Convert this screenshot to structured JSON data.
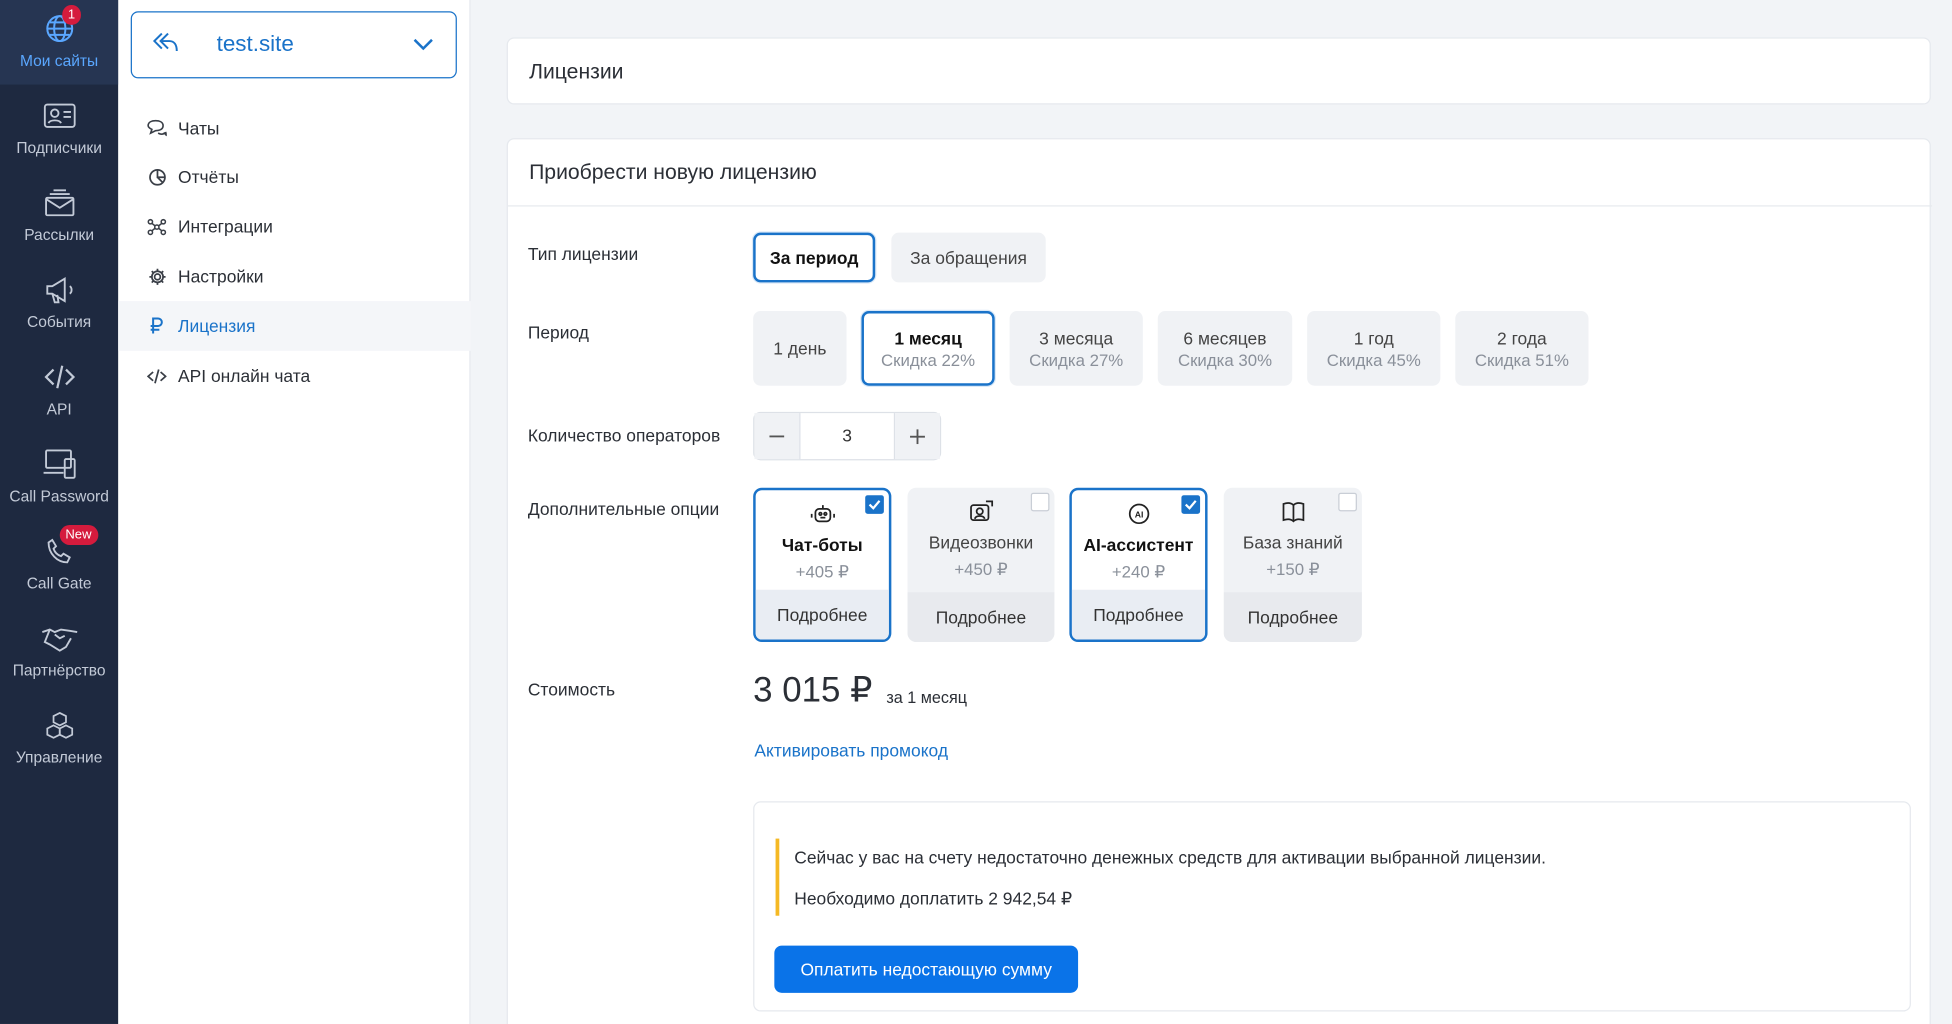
{
  "rail": {
    "items": [
      {
        "label": "Мои сайты",
        "icon": "globe-icon",
        "badge": "1"
      },
      {
        "label": "Подписчики",
        "icon": "contact-card-icon"
      },
      {
        "label": "Рассылки",
        "icon": "mail-stack-icon"
      },
      {
        "label": "События",
        "icon": "megaphone-icon"
      },
      {
        "label": "API",
        "icon": "code-icon"
      },
      {
        "label": "Call Password",
        "icon": "devices-icon"
      },
      {
        "label": "Call Gate",
        "icon": "phone-icon",
        "badge": "New"
      },
      {
        "label": "Партнёрство",
        "icon": "handshake-icon"
      },
      {
        "label": "Управление",
        "icon": "boxes-icon"
      }
    ]
  },
  "site": {
    "name": "test.site"
  },
  "nav": {
    "items": [
      {
        "label": "Чаты",
        "icon": "chat-icon"
      },
      {
        "label": "Отчёты",
        "icon": "pie-chart-icon"
      },
      {
        "label": "Интеграции",
        "icon": "integrations-icon"
      },
      {
        "label": "Настройки",
        "icon": "gear-icon"
      },
      {
        "label": "Лицензия",
        "icon": "ruble-icon"
      },
      {
        "label": "API онлайн чата",
        "icon": "code-icon"
      }
    ]
  },
  "page": {
    "title": "Лицензии"
  },
  "license": {
    "section_title": "Приобрести новую лицензию",
    "type_label": "Тип лицензии",
    "types": [
      "За период",
      "За обращения"
    ],
    "period_label": "Период",
    "periods": [
      {
        "title": "1 день",
        "sub": ""
      },
      {
        "title": "1 месяц",
        "sub": "Скидка 22%"
      },
      {
        "title": "3 месяца",
        "sub": "Скидка 27%"
      },
      {
        "title": "6 месяцев",
        "sub": "Скидка 30%"
      },
      {
        "title": "1 год",
        "sub": "Скидка 45%"
      },
      {
        "title": "2 года",
        "sub": "Скидка 51%"
      }
    ],
    "operators_label": "Количество операторов",
    "operators_value": "3",
    "options_label": "Дополнительные опции",
    "options": [
      {
        "title": "Чат-боты",
        "price": "+405 ₽",
        "more": "Подробнее",
        "checked": true,
        "icon": "bot-icon"
      },
      {
        "title": "Видеозвонки",
        "price": "+450 ₽",
        "more": "Подробнее",
        "checked": false,
        "icon": "video-call-icon"
      },
      {
        "title": "AI-ассистент",
        "price": "+240 ₽",
        "more": "Подробнее",
        "checked": true,
        "icon": "ai-icon"
      },
      {
        "title": "База знаний",
        "price": "+150 ₽",
        "more": "Подробнее",
        "checked": false,
        "icon": "book-icon"
      }
    ],
    "cost_label": "Стоимость",
    "cost_value": "3 015 ₽",
    "cost_period": "за 1 месяц",
    "promo_link": "Активировать промокод",
    "warning_line1": "Сейчас у вас на счету недостаточно денежных средств для активации выбранной лицензии.",
    "warning_line2": "Необходимо доплатить 2 942,54 ₽",
    "pay_button": "Оплатить недостающую сумму"
  },
  "colors": {
    "accent": "#1a73c9",
    "rail": "#1e2940",
    "warning": "#f5b924",
    "badge": "#d51b3d"
  }
}
